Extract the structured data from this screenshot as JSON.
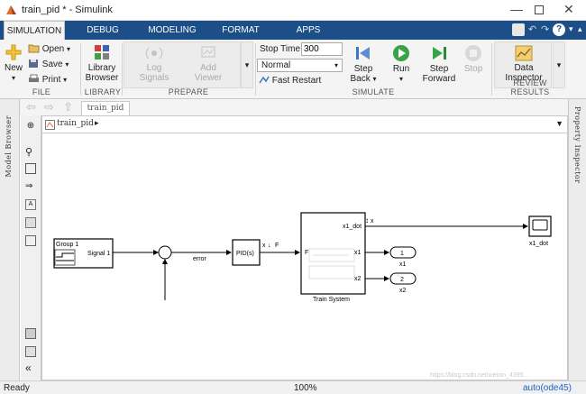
{
  "window": {
    "title": "train_pid * - Simulink"
  },
  "tabs": [
    {
      "label": "SIMULATION",
      "active": true
    },
    {
      "label": "DEBUG"
    },
    {
      "label": "MODELING"
    },
    {
      "label": "FORMAT"
    },
    {
      "label": "APPS"
    }
  ],
  "ribbon": {
    "file": {
      "section": "FILE",
      "new": "New",
      "open": "Open",
      "save": "Save",
      "print": "Print"
    },
    "library": {
      "section": "LIBRARY",
      "browser_line1": "Library",
      "browser_line2": "Browser"
    },
    "prepare": {
      "section": "PREPARE",
      "log_line1": "Log",
      "log_line2": "Signals",
      "add_line1": "Add",
      "add_line2": "Viewer"
    },
    "simulate": {
      "section": "SIMULATE",
      "stop_time_label": "Stop Time",
      "stop_time_value": "300",
      "mode": "Normal",
      "fast_restart": "Fast Restart",
      "step_back_line1": "Step",
      "step_back_line2": "Back",
      "run": "Run",
      "step_fwd_line1": "Step",
      "step_fwd_line2": "Forward",
      "stop": "Stop"
    },
    "review": {
      "section": "REVIEW RESULTS",
      "inspector_line1": "Data",
      "inspector_line2": "Inspector"
    }
  },
  "editor": {
    "model_tab": "train_pid",
    "breadcrumb": "train_pid",
    "left_panel_label": "Model Browser",
    "right_panel_label": "Property Inspector"
  },
  "diagram": {
    "group_label": "Group 1",
    "group_signal": "Signal 1",
    "error_label": "error",
    "pid_label": "PID(s)",
    "pid_out_x": "x",
    "pid_out_f": "F",
    "subsystem_in_f": "F",
    "subsystem_out_x1dot": "x1_dot",
    "subsystem_out_x1": "x1",
    "subsystem_out_x2": "x2",
    "subsystem_name": "Train System",
    "x1dot_signal_x": "x",
    "outport1_num": "1",
    "outport1_name": "x1",
    "outport2_num": "2",
    "outport2_name": "x2",
    "scope_name": "x1_dot",
    "sum_sign": "-"
  },
  "status": {
    "left": "Ready",
    "zoom": "100%",
    "solver": "auto(ode45)",
    "watermark": "https://blog.csdn.net/weixin_4395..."
  },
  "colors": {
    "tab_bar": "#1c4f87",
    "solver_link": "#1a63c8",
    "run_green": "#3aa34a"
  }
}
